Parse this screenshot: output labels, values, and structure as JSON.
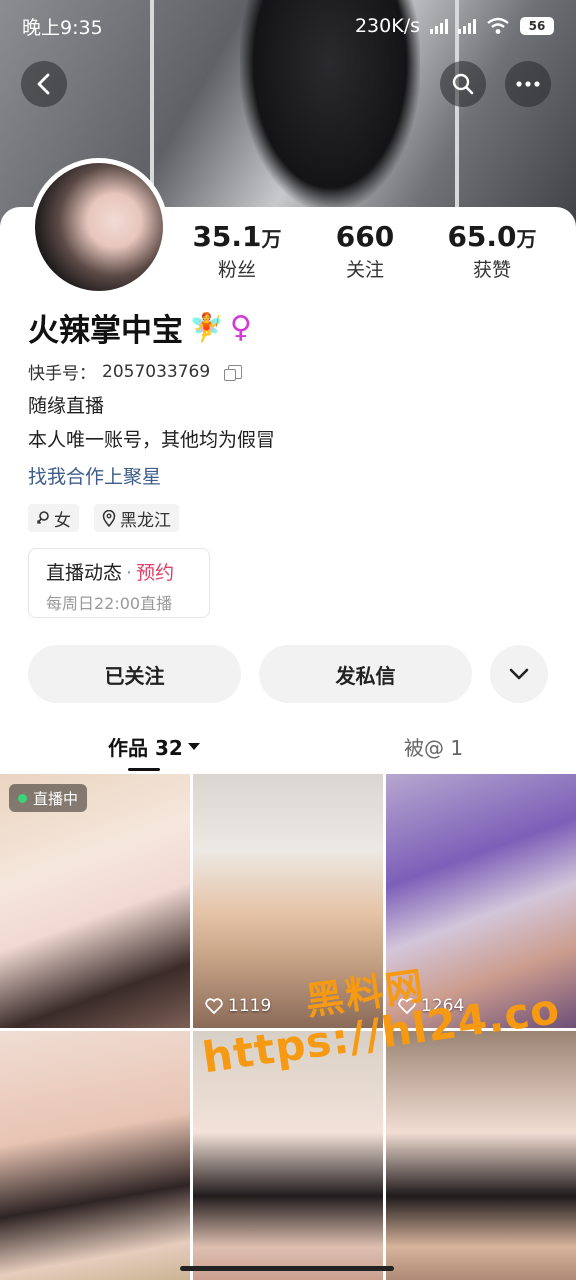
{
  "status_bar": {
    "time": "晚上9:35",
    "net_speed": "230K/s",
    "battery": "56"
  },
  "header": {
    "back_icon": "chevron-left-icon",
    "search_icon": "search-icon",
    "more_icon": "more-icon"
  },
  "profile": {
    "name": "火辣掌中宝",
    "name_emoji": "🧚",
    "gender_symbol": "♀",
    "id_label": "快手号：",
    "id_value": "2057033769",
    "bio_lines": [
      "随缘直播",
      "本人唯一账号，其他均为假冒"
    ],
    "coop_link": "找我合作上聚星",
    "tags": [
      {
        "icon": "female-icon",
        "label": "女"
      },
      {
        "icon": "location-icon",
        "label": "黑龙江"
      }
    ]
  },
  "stats": [
    {
      "num": "35.1",
      "unit": "万",
      "label": "粉丝"
    },
    {
      "num": "660",
      "unit": "",
      "label": "关注"
    },
    {
      "num": "65.0",
      "unit": "万",
      "label": "获赞"
    }
  ],
  "live_schedule": {
    "title": "直播动态",
    "separator": "·",
    "reserve": "预约",
    "subtitle": "每周日22:00直播"
  },
  "actions": {
    "follow": "已关注",
    "message": "发私信"
  },
  "tabs": {
    "works": "作品 32",
    "mentioned": "被@ 1"
  },
  "grid": [
    {
      "badge": "直播中",
      "likes": ""
    },
    {
      "badge": "",
      "likes": "1119"
    },
    {
      "badge": "",
      "likes": "1264"
    },
    {
      "badge": "",
      "likes": ""
    },
    {
      "badge": "",
      "likes": ""
    },
    {
      "badge": "",
      "likes": ""
    }
  ],
  "watermark": {
    "line1": "黑料网",
    "line2": "https://hl24.co"
  },
  "colors": {
    "link_blue": "#3d5d8a",
    "reserve_pink": "#e0406a",
    "watermark_orange": "#f59a12",
    "live_green": "#3ad37a"
  }
}
